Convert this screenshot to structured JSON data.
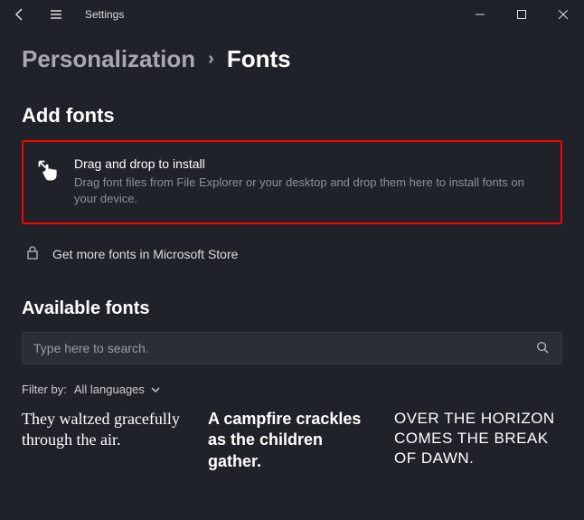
{
  "titlebar": {
    "title": "Settings"
  },
  "breadcrumb": {
    "parent": "Personalization",
    "current": "Fonts"
  },
  "addfonts": {
    "heading": "Add fonts",
    "drop_title": "Drag and drop to install",
    "drop_sub": "Drag font files from File Explorer or your desktop and drop them here to install fonts on your device.",
    "store_link": "Get more fonts in Microsoft Store"
  },
  "available": {
    "heading": "Available fonts",
    "search_placeholder": "Type here to search.",
    "filter_label": "Filter by:",
    "filter_value": "All languages"
  },
  "samples": {
    "s1": "They waltzed gracefully through the air.",
    "s2": "A campfire crackles as the children gather.",
    "s3": "Over the horizon comes the break of dawn."
  },
  "colors": {
    "highlight": "#ff0000",
    "bg": "#1f2229"
  }
}
